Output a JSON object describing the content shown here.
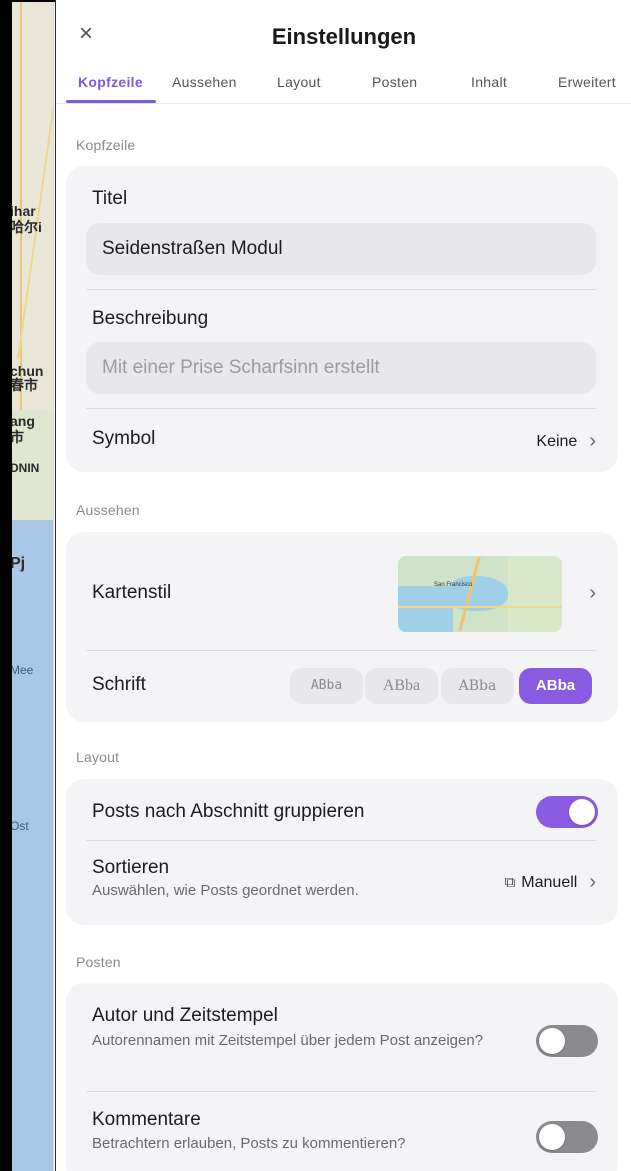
{
  "map_labels": [
    "ihar",
    "哈尔i",
    "chun",
    "春市",
    "ang",
    "市",
    "DNIN",
    "Pj",
    "Mee",
    "Ost"
  ],
  "header": {
    "close_icon": "close-icon",
    "title": "Einstellungen"
  },
  "tabs": [
    {
      "label": "Kopfzeile"
    },
    {
      "label": "Aussehen"
    },
    {
      "label": "Layout"
    },
    {
      "label": "Posten"
    },
    {
      "label": "Inhalt"
    },
    {
      "label": "Erweitert"
    }
  ],
  "sections": {
    "kopfzeile": {
      "label": "Kopfzeile",
      "title_label": "Titel",
      "title_value": "Seidenstraßen Modul",
      "description_label": "Beschreibung",
      "description_placeholder": "Mit einer Prise Scharfsinn erstellt",
      "symbol_label": "Symbol",
      "symbol_value": "Keine"
    },
    "aussehen": {
      "label": "Aussehen",
      "map_style_label": "Kartenstil",
      "map_thumb_text": "San Francisco",
      "font_label": "Schrift",
      "font_options": [
        "ABba",
        "ABba",
        "ABba",
        "ABba"
      ],
      "font_selected_index": 3
    },
    "layout": {
      "label": "Layout",
      "group_label": "Posts nach Abschnitt gruppieren",
      "group_on": true,
      "sort_label": "Sortieren",
      "sort_sub": "Auswählen, wie Posts geordnet werden.",
      "sort_value": "Manuell"
    },
    "posten": {
      "label": "Posten",
      "author_label": "Autor und Zeitstempel",
      "author_sub": "Autorennamen mit Zeitstempel über jedem Post anzeigen?",
      "author_on": false,
      "comments_label": "Kommentare",
      "comments_sub": "Betrachtern erlauben, Posts zu kommentieren?",
      "comments_on": false
    }
  },
  "colors": {
    "accent": "#8a5ae0",
    "tab_active": "#7a5ae0",
    "card_bg": "#f4f4f6",
    "toggle_off": "#8a8a8e"
  }
}
